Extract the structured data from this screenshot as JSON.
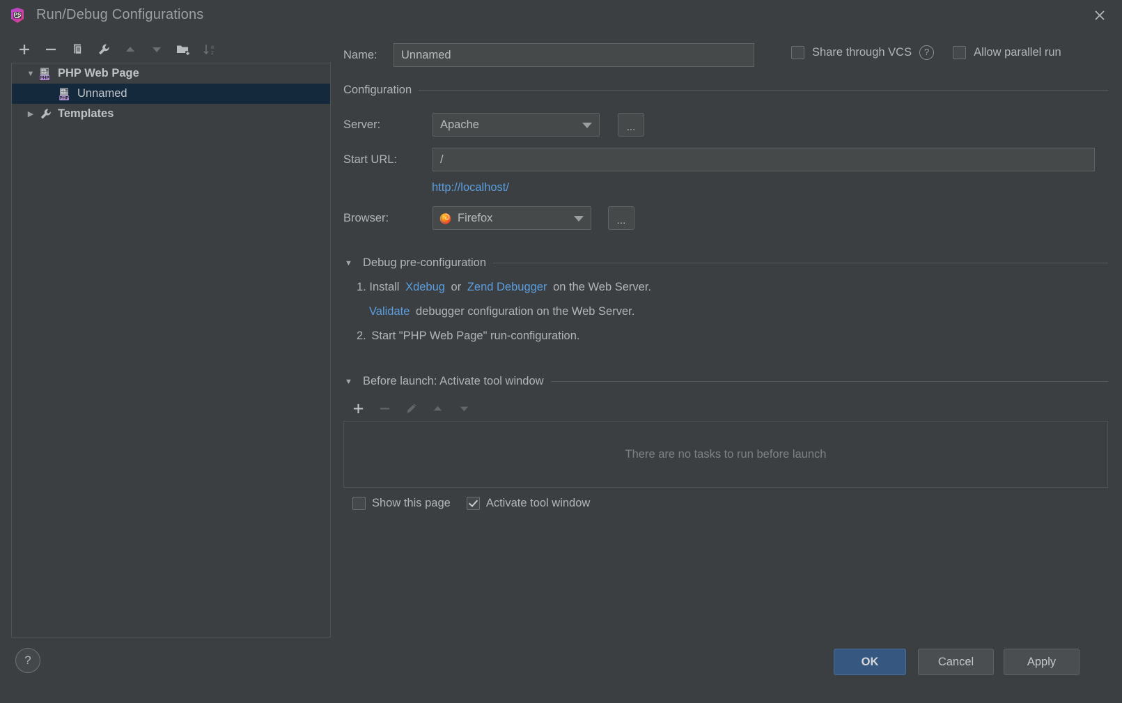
{
  "window": {
    "title": "Run/Debug Configurations",
    "app_icon": "phpstorm-logo-icon",
    "close_icon": "close-icon"
  },
  "left_panel": {
    "toolbar": [
      {
        "name": "add-configuration-button",
        "icon": "plus-icon",
        "enabled": true
      },
      {
        "name": "remove-configuration-button",
        "icon": "minus-icon",
        "enabled": true
      },
      {
        "name": "copy-configuration-button",
        "icon": "copy-icon",
        "enabled": true
      },
      {
        "name": "edit-templates-button",
        "icon": "wrench-icon",
        "enabled": true
      },
      {
        "name": "move-up-button",
        "icon": "arrow-up-icon",
        "enabled": false
      },
      {
        "name": "move-down-button",
        "icon": "arrow-down-icon",
        "enabled": false
      },
      {
        "name": "new-folder-button",
        "icon": "folder-add-icon",
        "enabled": true
      },
      {
        "name": "sort-alphabetically-button",
        "icon": "sort-az-icon",
        "enabled": false
      }
    ],
    "tree": [
      {
        "label": "PHP Web Page",
        "icon": "php-web-page-icon",
        "arrow": "▼",
        "selected": false,
        "bold": true,
        "indent": 0
      },
      {
        "label": "Unnamed",
        "icon": "php-web-page-icon",
        "arrow": "",
        "selected": true,
        "bold": false,
        "indent": 1
      },
      {
        "label": "Templates",
        "icon": "wrench-icon",
        "arrow": "▶",
        "selected": false,
        "bold": true,
        "indent": 0
      }
    ]
  },
  "form": {
    "name_label": "Name:",
    "name_value": "Unnamed",
    "share_through_vcs": {
      "label": "Share through VCS",
      "checked": false
    },
    "help_icon": "question-mark-icon",
    "allow_parallel_run": {
      "label": "Allow parallel run",
      "checked": false
    },
    "configuration_group": "Configuration",
    "server_label": "Server:",
    "server_value": "Apache",
    "server_browse_label": "...",
    "start_url_label": "Start URL:",
    "start_url_value": "/",
    "resolved_url": "http://localhost/",
    "browser_label": "Browser:",
    "browser_value": "Firefox",
    "browser_icon": "firefox-icon",
    "browser_browse_label": "...",
    "debug_group": "Debug pre-configuration",
    "debug_steps": {
      "step1_number": "1.",
      "step1_install": "Install",
      "step1_xdebug": "Xdebug",
      "step1_or": "or",
      "step1_zend": "Zend Debugger",
      "step1_tail": "on the Web Server.",
      "validate_link": "Validate",
      "validate_tail": "debugger configuration on the Web Server.",
      "step2_number": "2.",
      "step2_text": "Start \"PHP Web Page\" run-configuration."
    },
    "before_launch_group": "Before launch: Activate tool window",
    "before_launch_toolbar": [
      {
        "name": "add-task-button",
        "icon": "plus-icon",
        "enabled": true
      },
      {
        "name": "remove-task-button",
        "icon": "minus-icon",
        "enabled": false
      },
      {
        "name": "edit-task-button",
        "icon": "pencil-icon",
        "enabled": false
      },
      {
        "name": "task-move-up-button",
        "icon": "arrow-up-icon",
        "enabled": false
      },
      {
        "name": "task-move-down-button",
        "icon": "arrow-down-icon",
        "enabled": false
      }
    ],
    "tasks_empty_text": "There are no tasks to run before launch",
    "show_this_page": {
      "label": "Show this page",
      "checked": false
    },
    "activate_tool_window": {
      "label": "Activate tool window",
      "checked": true
    }
  },
  "footer": {
    "help_label": "?",
    "ok_label": "OK",
    "cancel_label": "Cancel",
    "apply_label": "Apply"
  },
  "colors": {
    "background": "#3c3f41",
    "selection": "#15293d",
    "accent_blue": "#365880",
    "link": "#5a9ee0",
    "text": "#b2b5b8",
    "border": "#5e6366"
  }
}
